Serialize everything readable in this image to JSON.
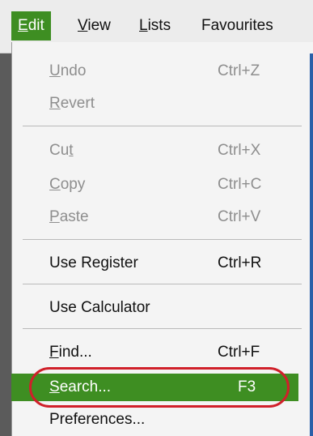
{
  "menubar": {
    "edit": {
      "mnemonic": "E",
      "rest": "dit"
    },
    "view": {
      "mnemonic": "V",
      "rest": "iew"
    },
    "lists": {
      "mnemonic": "L",
      "rest": "ists"
    },
    "favourites": {
      "label": "Favourites"
    }
  },
  "menu": {
    "undo": {
      "mnemonic": "U",
      "rest": "ndo",
      "shortcut": "Ctrl+Z"
    },
    "revert": {
      "mnemonic": "R",
      "rest": "evert"
    },
    "cut": {
      "pre": "Cu",
      "mnemonic": "t",
      "shortcut": "Ctrl+X"
    },
    "copy": {
      "mnemonic": "C",
      "rest": "opy",
      "shortcut": "Ctrl+C"
    },
    "paste": {
      "mnemonic": "P",
      "rest": "aste",
      "shortcut": "Ctrl+V"
    },
    "use_register": {
      "label": "Use Register",
      "shortcut": "Ctrl+R"
    },
    "use_calculator": {
      "label": "Use Calculator"
    },
    "find": {
      "mnemonic": "F",
      "rest": "ind...",
      "shortcut": "Ctrl+F"
    },
    "search": {
      "mnemonic": "S",
      "rest": "earch...",
      "shortcut": "F3"
    },
    "preferences": {
      "label": "Preferences..."
    }
  },
  "colors": {
    "highlight": "#3e8e22",
    "annotation_oval": "#d0202a",
    "disabled_text": "#8e8e8e"
  }
}
